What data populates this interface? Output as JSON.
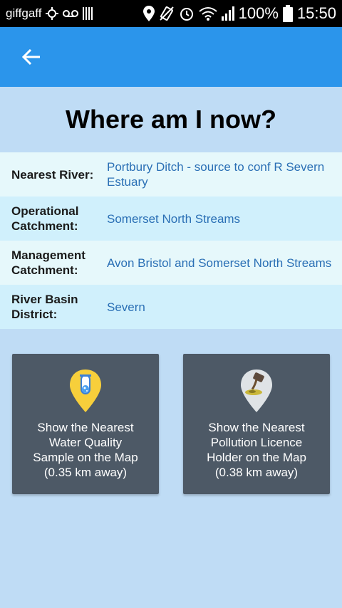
{
  "status_bar": {
    "carrier": "giffgaff",
    "battery": "100%",
    "time": "15:50"
  },
  "app_bar": {
    "back_icon": "arrow-left-icon",
    "color": "#2b95eb"
  },
  "page": {
    "title": "Where am I now?"
  },
  "info": [
    {
      "label": "Nearest River:",
      "value": "Portbury Ditch - source to conf R Severn Estuary"
    },
    {
      "label": "Operational Catchment:",
      "value": "Somerset North Streams"
    },
    {
      "label": "Management Catchment:",
      "value": "Avon Bristol and Somerset North Streams"
    },
    {
      "label": "River Basin District:",
      "value": "Severn"
    }
  ],
  "actions": [
    {
      "icon": "water-sample-pin-icon",
      "line1": "Show the Nearest",
      "line2": "Water Quality",
      "line3": "Sample on the Map",
      "line4": "(0.35 km away)"
    },
    {
      "icon": "pollution-pin-icon",
      "line1": "Show the Nearest",
      "line2": "Pollution Licence",
      "line3": "Holder on the Map",
      "line4": "(0.38 km away)"
    }
  ],
  "colors": {
    "background": "#bfdcf5",
    "card": "#4d5966",
    "link": "#2a6fb5"
  }
}
